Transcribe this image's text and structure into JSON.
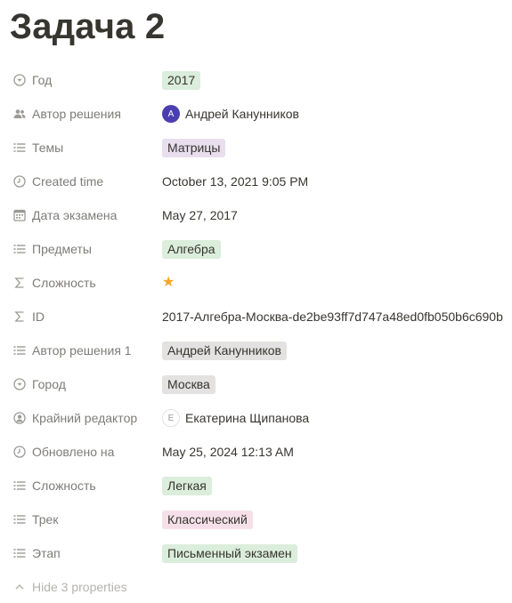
{
  "page": {
    "title": "Задача 2"
  },
  "tag_colors": {
    "green": "#dbeddb",
    "purple": "#e8deee",
    "gray": "#e3e2e0",
    "pink": "#f5e0e9"
  },
  "properties": [
    {
      "label": "Год",
      "icon": "dropdown-circle-icon",
      "value": "2017",
      "kind": "tag",
      "color": "green"
    },
    {
      "label": "Автор решения",
      "icon": "people-icon",
      "value": "Андрей Канунников",
      "kind": "person",
      "avatar_letter": "А"
    },
    {
      "label": "Темы",
      "icon": "list-icon",
      "value": "Матрицы",
      "kind": "tag",
      "color": "purple"
    },
    {
      "label": "Created time",
      "icon": "clock-icon",
      "value": "October 13, 2021 9:05 PM",
      "kind": "text"
    },
    {
      "label": "Дата экзамена",
      "icon": "calendar-icon",
      "value": "May 27, 2017",
      "kind": "text"
    },
    {
      "label": "Предметы",
      "icon": "list-icon",
      "value": "Алгебра",
      "kind": "tag",
      "color": "green"
    },
    {
      "label": "Сложность",
      "icon": "sigma-icon",
      "value": "★",
      "kind": "star"
    },
    {
      "label": "ID",
      "icon": "sigma-icon",
      "value": "2017-Алгебра-Москва-de2be93ff7d747a48ed0fb050b6c690b",
      "kind": "text"
    },
    {
      "label": "Автор решения 1",
      "icon": "list-icon",
      "value": "Андрей Канунников",
      "kind": "tag",
      "color": "gray"
    },
    {
      "label": "Город",
      "icon": "dropdown-circle-icon",
      "value": "Москва",
      "kind": "tag",
      "color": "gray"
    },
    {
      "label": "Крайний редактор",
      "icon": "user-circle-icon",
      "value": "Екатерина Щипанова",
      "kind": "person",
      "avatar_letter": "Е"
    },
    {
      "label": "Обновлено на",
      "icon": "clock-icon",
      "value": "May 25, 2024 12:13 AM",
      "kind": "text"
    },
    {
      "label": "Сложность",
      "icon": "list-icon",
      "value": "Легкая",
      "kind": "tag",
      "color": "green"
    },
    {
      "label": "Трек",
      "icon": "list-icon",
      "value": "Классический",
      "kind": "tag",
      "color": "pink"
    },
    {
      "label": "Этап",
      "icon": "list-icon",
      "value": "Письменный экзамен",
      "kind": "tag",
      "color": "green"
    }
  ],
  "footer": {
    "hide_label": "Hide 3 properties",
    "icon": "chevron-up-icon"
  }
}
